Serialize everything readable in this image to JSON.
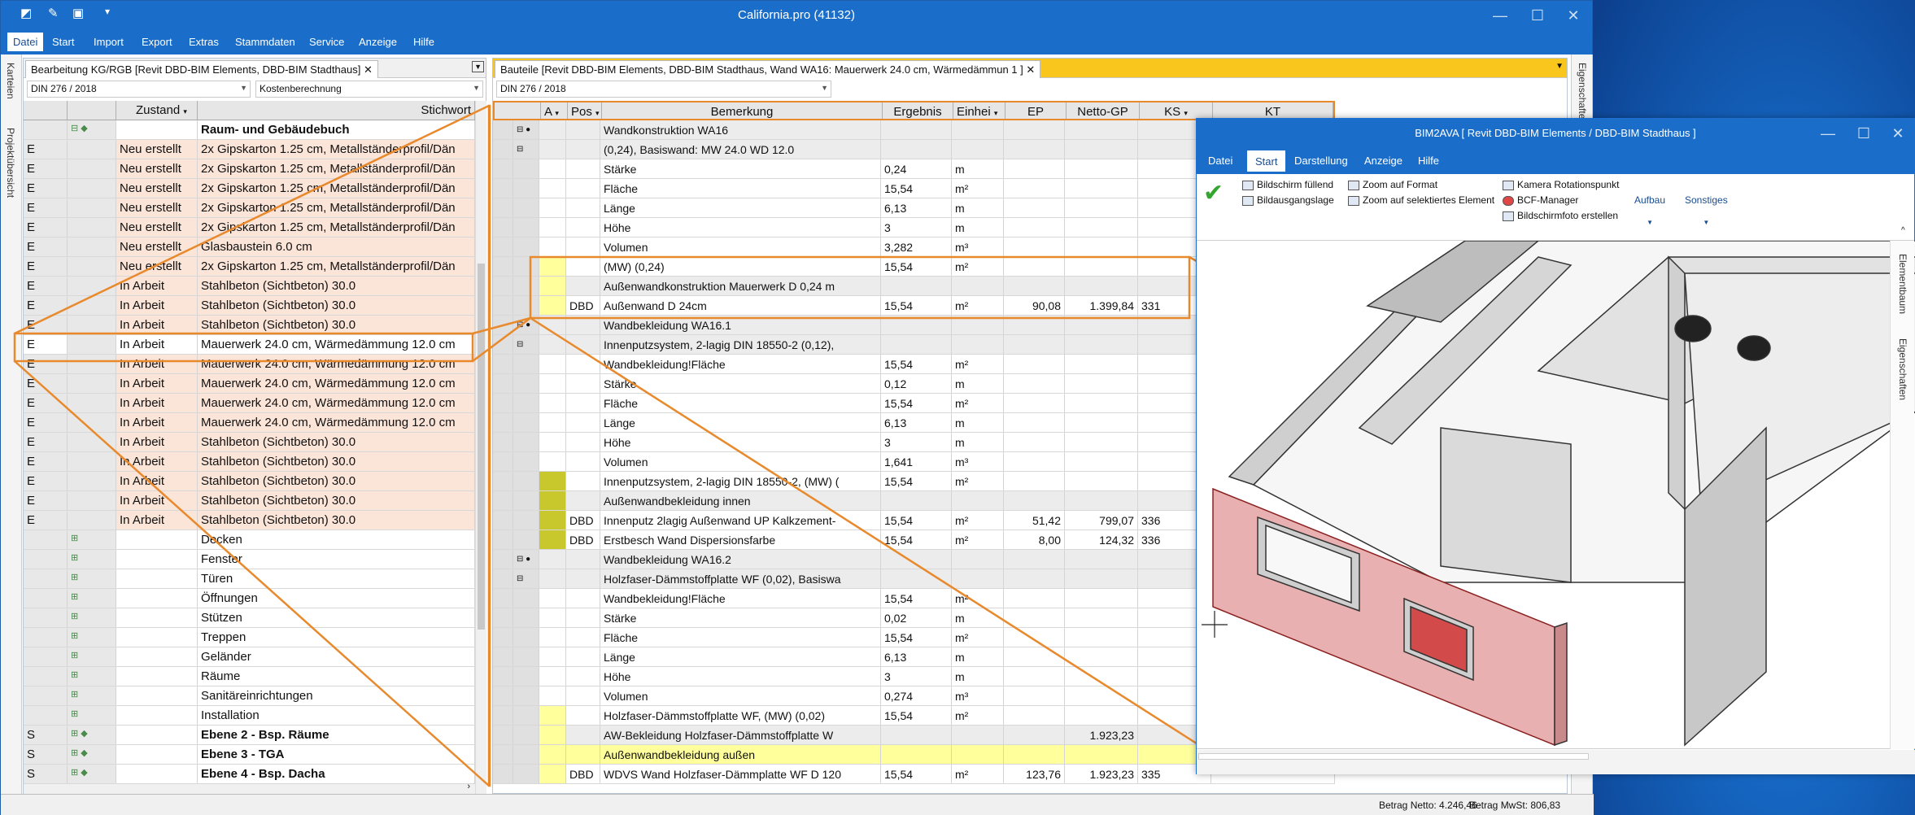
{
  "desktop": {
    "accent": "#1a6ec9"
  },
  "app": {
    "title": "California.pro (41132)"
  },
  "menu": [
    "Datei",
    "Start",
    "Import",
    "Export",
    "Extras",
    "Stammdaten",
    "Service",
    "Anzeige",
    "Hilfe"
  ],
  "left_strip": [
    "Karteien",
    "Projektübersicht"
  ],
  "right_strip": [
    "Eigenschaften"
  ],
  "left_panel": {
    "tab": "Bearbeitung KG/RGB [Revit DBD-BIM Elements, DBD-BIM Stadthaus]",
    "combo1": "DIN 276 / 2018",
    "combo2": "Kostenberechnung",
    "headers": [
      "Zustand",
      "Stichwort"
    ],
    "rows": [
      {
        "a": "",
        "z": "",
        "s": "Raum- und Gebäudebuch",
        "bold": true,
        "tree": "⊟ ◆"
      },
      {
        "a": "E",
        "z": "Neu erstellt",
        "s": "2x Gipskarton 1.25  cm, Metallständerprofil/Dän"
      },
      {
        "a": "E",
        "z": "Neu erstellt",
        "s": "2x Gipskarton 1.25  cm, Metallständerprofil/Dän"
      },
      {
        "a": "E",
        "z": "Neu erstellt",
        "s": "2x Gipskarton 1.25  cm, Metallständerprofil/Dän"
      },
      {
        "a": "E",
        "z": "Neu erstellt",
        "s": "2x Gipskarton 1.25  cm, Metallständerprofil/Dän"
      },
      {
        "a": "E",
        "z": "Neu erstellt",
        "s": "2x Gipskarton 1.25  cm, Metallständerprofil/Dän"
      },
      {
        "a": "E",
        "z": "Neu erstellt",
        "s": "Glasbaustein 6.0 cm"
      },
      {
        "a": "E",
        "z": "Neu erstellt",
        "s": "2x Gipskarton 1.25  cm, Metallständerprofil/Dän"
      },
      {
        "a": "E",
        "z": "In Arbeit",
        "s": "Stahlbeton (Sichtbeton) 30.0"
      },
      {
        "a": "E",
        "z": "In Arbeit",
        "s": "Stahlbeton (Sichtbeton) 30.0"
      },
      {
        "a": "E",
        "z": "In Arbeit",
        "s": "Stahlbeton (Sichtbeton) 30.0"
      },
      {
        "a": "E",
        "z": "In Arbeit",
        "s": "Mauerwerk 24.0 cm, Wärmedämmung 12.0 cm",
        "sel": true
      },
      {
        "a": "E",
        "z": "In Arbeit",
        "s": "Mauerwerk 24.0 cm, Wärmedämmung 12.0 cm"
      },
      {
        "a": "E",
        "z": "In Arbeit",
        "s": "Mauerwerk 24.0 cm, Wärmedämmung 12.0 cm"
      },
      {
        "a": "E",
        "z": "In Arbeit",
        "s": "Mauerwerk 24.0 cm, Wärmedämmung 12.0 cm"
      },
      {
        "a": "E",
        "z": "In Arbeit",
        "s": "Mauerwerk 24.0 cm, Wärmedämmung 12.0 cm"
      },
      {
        "a": "E",
        "z": "In Arbeit",
        "s": "Stahlbeton (Sichtbeton) 30.0"
      },
      {
        "a": "E",
        "z": "In Arbeit",
        "s": "Stahlbeton (Sichtbeton) 30.0"
      },
      {
        "a": "E",
        "z": "In Arbeit",
        "s": "Stahlbeton (Sichtbeton) 30.0"
      },
      {
        "a": "E",
        "z": "In Arbeit",
        "s": "Stahlbeton (Sichtbeton) 30.0"
      },
      {
        "a": "E",
        "z": "In Arbeit",
        "s": "Stahlbeton (Sichtbeton) 30.0"
      },
      {
        "a": "",
        "z": "",
        "s": "Decken",
        "tree": "⊞"
      },
      {
        "a": "",
        "z": "",
        "s": "Fenster",
        "tree": "⊞"
      },
      {
        "a": "",
        "z": "",
        "s": "Türen",
        "tree": "⊞"
      },
      {
        "a": "",
        "z": "",
        "s": "Öffnungen",
        "tree": "⊞"
      },
      {
        "a": "",
        "z": "",
        "s": "Stützen",
        "tree": "⊞"
      },
      {
        "a": "",
        "z": "",
        "s": "Treppen",
        "tree": "⊞"
      },
      {
        "a": "",
        "z": "",
        "s": "Geländer",
        "tree": "⊞"
      },
      {
        "a": "",
        "z": "",
        "s": "Räume",
        "tree": "⊞"
      },
      {
        "a": "",
        "z": "",
        "s": "Sanitäreinrichtungen",
        "tree": "⊞"
      },
      {
        "a": "",
        "z": "",
        "s": "Installation",
        "tree": "⊞"
      },
      {
        "a": "S",
        "z": "",
        "s": "Ebene 2 - Bsp. Räume",
        "bold": true,
        "tree": "⊞ ◆"
      },
      {
        "a": "S",
        "z": "",
        "s": "Ebene 3 - TGA",
        "bold": true,
        "tree": "⊞ ◆"
      },
      {
        "a": "S",
        "z": "",
        "s": "Ebene 4 - Bsp. Dacha",
        "bold": true,
        "tree": "⊞ ◆"
      }
    ]
  },
  "right_panel": {
    "tab": "Bauteile [Revit DBD-BIM Elements, DBD-BIM Stadthaus, Wand WA16: Mauerwerk 24.0 cm, Wärmedämmun   1  ]",
    "combo1": "DIN 276 / 2018",
    "headers": [
      "A",
      "Pos",
      "Bemerkung",
      "Ergebnis",
      "Einhei",
      "EP",
      "Netto-GP",
      "KS",
      "KT"
    ],
    "rows": [
      {
        "t": "⊟ ●",
        "a": "",
        "p": "",
        "b": "Wandkonstruktion WA16",
        "e": "",
        "u": "",
        "ep": "",
        "n": "",
        "ks": "",
        "h": "g"
      },
      {
        "t": "⊟",
        "a": "",
        "p": "",
        "b": "(0,24), Basiswand: MW 24.0 WD 12.0",
        "e": "",
        "u": "",
        "ep": "",
        "n": "",
        "ks": "",
        "h": "g"
      },
      {
        "t": "",
        "a": "",
        "p": "",
        "b": "Stärke",
        "e": "0,24",
        "u": "m",
        "ep": "",
        "n": "",
        "ks": ""
      },
      {
        "t": "",
        "a": "",
        "p": "",
        "b": "Fläche",
        "e": "15,54",
        "u": "m²",
        "ep": "",
        "n": "",
        "ks": ""
      },
      {
        "t": "",
        "a": "",
        "p": "",
        "b": "Länge",
        "e": "6,13",
        "u": "m",
        "ep": "",
        "n": "",
        "ks": ""
      },
      {
        "t": "",
        "a": "",
        "p": "",
        "b": "Höhe",
        "e": "3",
        "u": "m",
        "ep": "",
        "n": "",
        "ks": ""
      },
      {
        "t": "",
        "a": "",
        "p": "",
        "b": "Volumen",
        "e": "3,282",
        "u": "m³",
        "ep": "",
        "n": "",
        "ks": ""
      },
      {
        "t": "",
        "a": "y",
        "p": "",
        "b": "(MW) (0,24)",
        "e": "15,54",
        "u": "m²",
        "ep": "",
        "n": "",
        "ks": ""
      },
      {
        "t": "",
        "a": "y",
        "p": "",
        "b": "Außenwandkonstruktion Mauerwerk D 0,24 m",
        "e": "",
        "u": "",
        "ep": "",
        "n": "",
        "ks": "",
        "h": "g"
      },
      {
        "t": "",
        "a": "y",
        "p": "DBD",
        "b": "Außenwand D 24cm",
        "e": "15,54",
        "u": "m²",
        "ep": "90,08",
        "n": "1.399,84",
        "ks": "331"
      },
      {
        "t": "⊟ ●",
        "a": "",
        "p": "",
        "b": "Wandbekleidung WA16.1",
        "e": "",
        "u": "",
        "ep": "",
        "n": "",
        "ks": "",
        "h": "g"
      },
      {
        "t": "⊟",
        "a": "",
        "p": "",
        "b": "Innenputzsystem, 2-lagig DIN 18550-2 (0,12),",
        "e": "",
        "u": "",
        "ep": "",
        "n": "",
        "ks": "",
        "h": "g"
      },
      {
        "t": "",
        "a": "",
        "p": "",
        "b": "Wandbekleidung!Fläche",
        "e": "15,54",
        "u": "m²",
        "ep": "",
        "n": "",
        "ks": ""
      },
      {
        "t": "",
        "a": "",
        "p": "",
        "b": "Stärke",
        "e": "0,12",
        "u": "m",
        "ep": "",
        "n": "",
        "ks": ""
      },
      {
        "t": "",
        "a": "",
        "p": "",
        "b": "Fläche",
        "e": "15,54",
        "u": "m²",
        "ep": "",
        "n": "",
        "ks": ""
      },
      {
        "t": "",
        "a": "",
        "p": "",
        "b": "Länge",
        "e": "6,13",
        "u": "m",
        "ep": "",
        "n": "",
        "ks": ""
      },
      {
        "t": "",
        "a": "",
        "p": "",
        "b": "Höhe",
        "e": "3",
        "u": "m",
        "ep": "",
        "n": "",
        "ks": ""
      },
      {
        "t": "",
        "a": "",
        "p": "",
        "b": "Volumen",
        "e": "1,641",
        "u": "m³",
        "ep": "",
        "n": "",
        "ks": ""
      },
      {
        "t": "",
        "a": "o",
        "p": "",
        "b": "Innenputzsystem, 2-lagig DIN 18550-2, (MW) (",
        "e": "15,54",
        "u": "m²",
        "ep": "",
        "n": "",
        "ks": ""
      },
      {
        "t": "",
        "a": "o",
        "p": "",
        "b": "Außenwandbekleidung innen",
        "e": "",
        "u": "",
        "ep": "",
        "n": "",
        "ks": "",
        "h": "g"
      },
      {
        "t": "",
        "a": "o",
        "p": "DBD",
        "b": "Innenputz 2lagig Außenwand UP Kalkzement-",
        "e": "15,54",
        "u": "m²",
        "ep": "51,42",
        "n": "799,07",
        "ks": "336"
      },
      {
        "t": "",
        "a": "o",
        "p": "DBD",
        "b": "Erstbesch Wand Dispersionsfarbe",
        "e": "15,54",
        "u": "m²",
        "ep": "8,00",
        "n": "124,32",
        "ks": "336"
      },
      {
        "t": "⊟ ●",
        "a": "",
        "p": "",
        "b": "Wandbekleidung WA16.2",
        "e": "",
        "u": "",
        "ep": "",
        "n": "",
        "ks": "",
        "h": "g"
      },
      {
        "t": "⊟",
        "a": "",
        "p": "",
        "b": "Holzfaser-Dämmstoffplatte  WF  (0,02), Basiswa",
        "e": "",
        "u": "",
        "ep": "",
        "n": "",
        "ks": "",
        "h": "g"
      },
      {
        "t": "",
        "a": "",
        "p": "",
        "b": "Wandbekleidung!Fläche",
        "e": "15,54",
        "u": "m²",
        "ep": "",
        "n": "",
        "ks": ""
      },
      {
        "t": "",
        "a": "",
        "p": "",
        "b": "Stärke",
        "e": "0,02",
        "u": "m",
        "ep": "",
        "n": "",
        "ks": ""
      },
      {
        "t": "",
        "a": "",
        "p": "",
        "b": "Fläche",
        "e": "15,54",
        "u": "m²",
        "ep": "",
        "n": "",
        "ks": ""
      },
      {
        "t": "",
        "a": "",
        "p": "",
        "b": "Länge",
        "e": "6,13",
        "u": "m",
        "ep": "",
        "n": "",
        "ks": ""
      },
      {
        "t": "",
        "a": "",
        "p": "",
        "b": "Höhe",
        "e": "3",
        "u": "m",
        "ep": "",
        "n": "",
        "ks": ""
      },
      {
        "t": "",
        "a": "",
        "p": "",
        "b": "Volumen",
        "e": "0,274",
        "u": "m³",
        "ep": "",
        "n": "",
        "ks": ""
      },
      {
        "t": "",
        "a": "y",
        "p": "",
        "b": "Holzfaser-Dämmstoffplatte WF, (MW) (0,02)",
        "e": "15,54",
        "u": "m²",
        "ep": "",
        "n": "",
        "ks": ""
      },
      {
        "t": "",
        "a": "y",
        "p": "",
        "b": "AW-Bekleidung  Holzfaser-Dämmstoffplatte W",
        "e": "",
        "u": "",
        "ep": "",
        "n": "1.923,23",
        "ks": "",
        "h": "g"
      },
      {
        "t": "",
        "a": "y",
        "p": "",
        "b": "Außenwandbekleidung außen",
        "e": "",
        "u": "",
        "ep": "",
        "n": "",
        "ks": "",
        "h": "y"
      },
      {
        "t": "",
        "a": "y",
        "p": "DBD",
        "b": "WDVS  Wand  Holzfaser-Dämmplatte  WF  D 120",
        "e": "15,54",
        "u": "m²",
        "ep": "123,76",
        "n": "1.923,23",
        "ks": "335"
      }
    ]
  },
  "status": {
    "netto": "Betrag Netto: 4.246,46",
    "mwst": "Betrag MwSt: 806,83"
  },
  "bim": {
    "title": "BIM2AVA [ Revit DBD-BIM Elements /  DBD-BIM Stadthaus ]",
    "tabs": [
      "Datei",
      "Start",
      "Darstellung",
      "Anzeige",
      "Hilfe"
    ],
    "ribbon": {
      "fill": "Bildschirm füllend",
      "start": "Bildausgangslage",
      "zoomformat": "Zoom auf Format",
      "zoomsel": "Zoom auf selektiertes Element",
      "kamera": "Kamera Rotationspunkt",
      "bcf": "BCF-Manager",
      "shot": "Bildschirmfoto erstellen",
      "aufbau": "Aufbau",
      "sonstiges": "Sonstiges"
    },
    "side": [
      "Elementbaum",
      "Eigenschaften"
    ]
  }
}
